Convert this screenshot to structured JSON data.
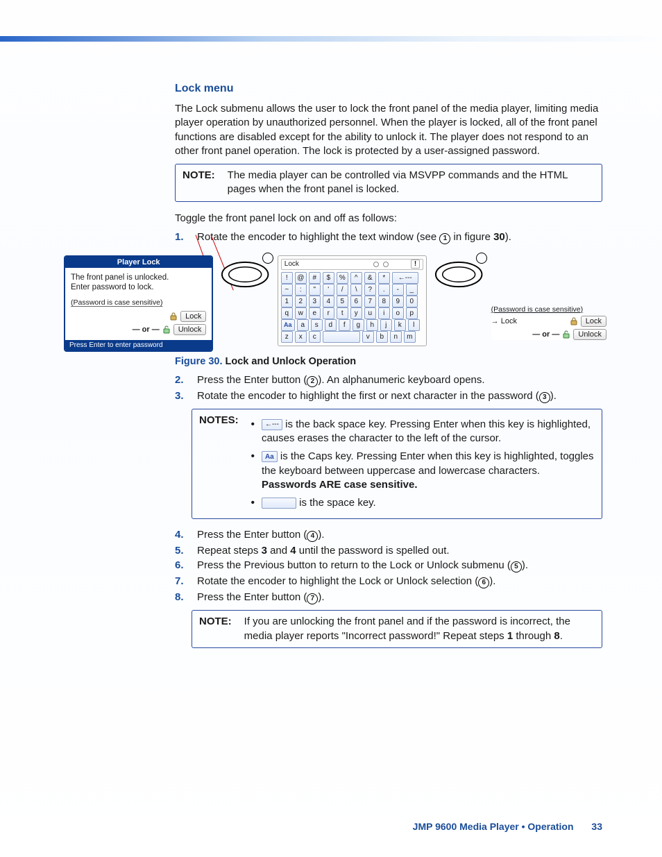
{
  "heading": "Lock menu",
  "intro": "The Lock submenu allows the user to lock the front panel of the media player, limiting media player operation by unauthorized personnel. When the player is locked, all of the front panel functions are disabled except for the ability to unlock it. The player does not respond to an other front panel operation. The lock is protected by a user-assigned password.",
  "note1_label": "NOTE:",
  "note1_body": "The media player can be controlled via MSVPP commands and the HTML pages when the front panel is locked.",
  "toggle_intro": "Toggle the front panel lock on and off as follows:",
  "steps_a": {
    "1": {
      "n": "1.",
      "t_a": "Rotate the encoder to highlight the text window (see ",
      "t_b": " in figure ",
      "t_c": ").",
      "fig": "30"
    }
  },
  "fig30": {
    "panel1": {
      "title": "Player Lock",
      "msg1": "The front panel is unlocked.",
      "msg2": "Enter password to lock.",
      "hint": "(Password is case sensitive)",
      "lock": "Lock",
      "or": "— or —",
      "unlock": "Unlock",
      "foot": "Press Enter to enter password"
    },
    "kbd": {
      "label": "Lock",
      "rows": [
        [
          "!",
          "@",
          "#",
          "$",
          "%",
          "^",
          "&",
          "*",
          "←---"
        ],
        [
          "~",
          ":",
          "\"",
          "'",
          "/",
          "\\",
          "?",
          ".",
          "-",
          "_"
        ],
        [
          "1",
          "2",
          "3",
          "4",
          "5",
          "6",
          "7",
          "8",
          "9",
          "0"
        ],
        [
          "q",
          "w",
          "e",
          "r",
          "t",
          "y",
          "u",
          "i",
          "o",
          "p"
        ],
        [
          "Aa",
          "a",
          "s",
          "d",
          "f",
          "g",
          "h",
          "j",
          "k",
          "l"
        ],
        [
          "z",
          "x",
          "c",
          "",
          "",
          "",
          "v",
          "b",
          "n",
          "m"
        ]
      ]
    },
    "panel3": {
      "hint": "(Password is case sensitive)",
      "lock": "Lock",
      "or": "— or —",
      "unlock": "Unlock"
    }
  },
  "caption": {
    "figno": "Figure 30.",
    "txt": " Lock and Unlock Operation"
  },
  "steps_b": {
    "2": {
      "n": "2.",
      "t": "Press the Enter button (",
      "t2": "). An alphanumeric keyboard opens."
    },
    "3": {
      "n": "3.",
      "t": "Rotate the encoder to highlight the first or next character in the password (",
      "t2": ")."
    }
  },
  "notes2_label": "NOTES:",
  "notes2": {
    "a": {
      "key": "←---",
      "t": " is the back space key. Pressing Enter when this key is highlighted, causes erases the character to the left of the cursor."
    },
    "b": {
      "key": "Aa",
      "t1": " is the Caps key. Pressing Enter when this key is highlighted, toggles the keyboard between uppercase and lowercase characters. ",
      "bold": "Passwords ARE case sensitive."
    },
    "c": {
      "t": " is the space key."
    }
  },
  "steps_c": {
    "4": {
      "n": "4.",
      "t": "Press the Enter button (",
      "t2": ")."
    },
    "5": {
      "n": "5.",
      "t_a": "Repeat steps ",
      "b1": "3",
      "t_b": " and ",
      "b2": "4",
      "t_c": " until the password is spelled out."
    },
    "6": {
      "n": "6.",
      "t": "Press the Previous button to return to the Lock or Unlock submenu (",
      "t2": ")."
    },
    "7": {
      "n": "7.",
      "t": "Rotate the encoder to highlight the Lock or Unlock selection (",
      "t2": ")."
    },
    "8": {
      "n": "8.",
      "t": "Press the Enter button (",
      "t2": ")."
    }
  },
  "note3_label": "NOTE:",
  "note3": {
    "t_a": "If you are unlocking the front panel and if the password is incorrect, the media player reports \"Incorrect password!\" Repeat steps ",
    "b1": "1",
    "t_b": " through ",
    "b2": "8",
    "t_c": "."
  },
  "footer": {
    "title": "JMP 9600 Media Player • Operation",
    "page": "33"
  }
}
